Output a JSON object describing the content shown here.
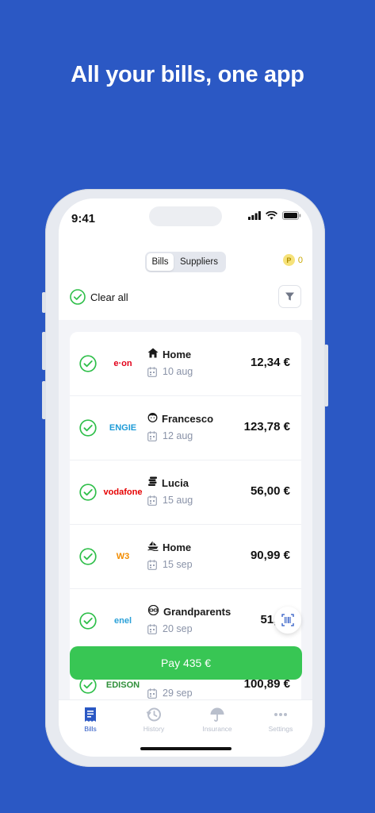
{
  "headline": "All your bills, one app",
  "status_bar": {
    "time": "9:41"
  },
  "segmented": {
    "bills": "Bills",
    "suppliers": "Suppliers"
  },
  "points": {
    "coin_symbol": "P",
    "value": "0"
  },
  "clear_all": "Clear all",
  "bills": [
    {
      "supplier_logo": "e·on",
      "logo_color": "#e2001a",
      "icon": "house-icon",
      "name": "Home",
      "date": "10 aug",
      "amount": "12,34 €"
    },
    {
      "supplier_logo": "ENGIE",
      "logo_color": "#1e9bd7",
      "icon": "face-icon",
      "name": "Francesco",
      "date": "12 aug",
      "amount": "123,78 €"
    },
    {
      "supplier_logo": "vodafone",
      "logo_color": "#e60000",
      "icon": "coins-icon",
      "name": "Lucia",
      "date": "15 aug",
      "amount": "56,00 €"
    },
    {
      "supplier_logo": "W3",
      "logo_color": "#f28c00",
      "icon": "boat-icon",
      "name": "Home",
      "date": "15 sep",
      "amount": "90,99 €"
    },
    {
      "supplier_logo": "enel",
      "logo_color": "#2aa0d8",
      "icon": "glasses-icon",
      "name": "Grandparents",
      "date": "20 sep",
      "amount": "51,00"
    },
    {
      "supplier_logo": "EDISON",
      "logo_color": "#2f8f3a",
      "icon": "person-icon",
      "name": "",
      "date": "29 sep",
      "amount": "100,89 €"
    }
  ],
  "pay_button": "Pay 435 €",
  "tabs": [
    {
      "label": "Bills",
      "icon": "receipt-icon",
      "active": true
    },
    {
      "label": "History",
      "icon": "history-icon",
      "active": false
    },
    {
      "label": "Insurance",
      "icon": "umbrella-icon",
      "active": false
    },
    {
      "label": "Settings",
      "icon": "dots-icon",
      "active": false
    }
  ],
  "colors": {
    "background": "#2b58c4",
    "accent_green": "#38c654",
    "check_green": "#2fbf4a"
  }
}
